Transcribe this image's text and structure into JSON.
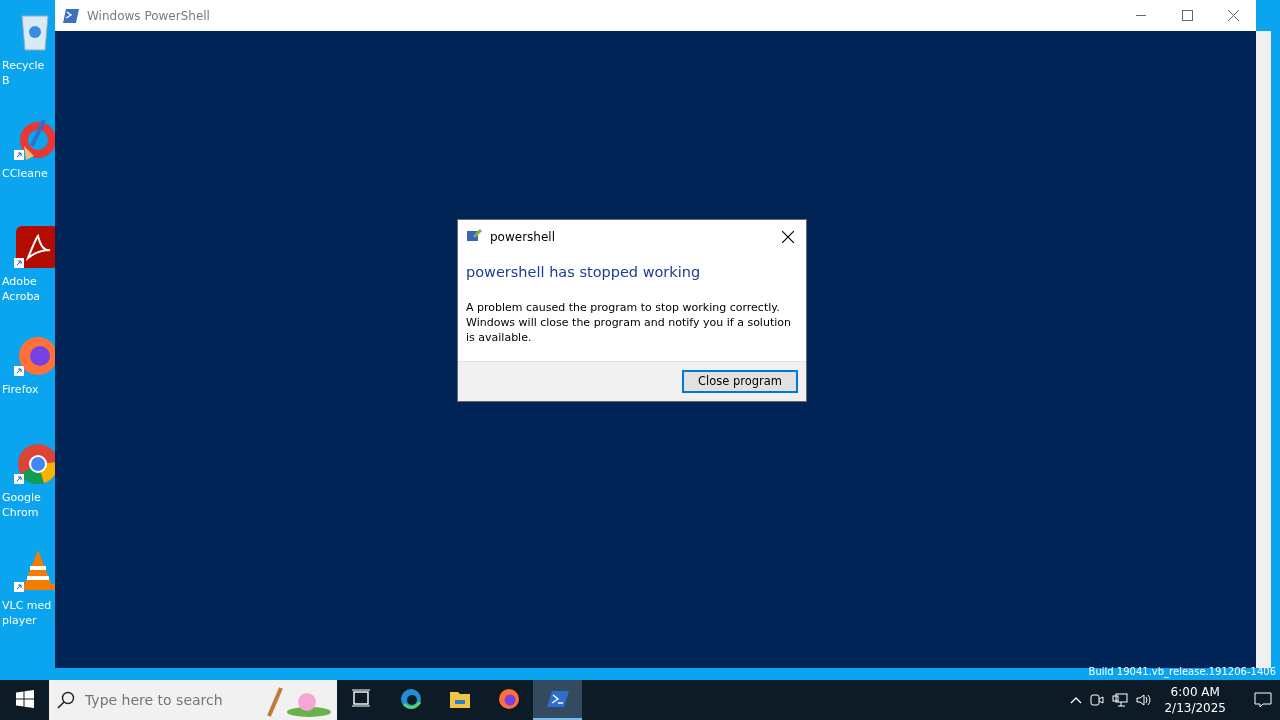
{
  "desktop_icons": [
    {
      "kind": "recycle",
      "label": "Recycle B"
    },
    {
      "kind": "ccleaner",
      "label": "CCleane"
    },
    {
      "kind": "acrobat",
      "label": "Adobe Acroba"
    },
    {
      "kind": "firefox",
      "label": "Firefox"
    },
    {
      "kind": "chrome",
      "label": "Google Chrom"
    },
    {
      "kind": "vlc",
      "label": "VLC med player"
    }
  ],
  "window": {
    "title": "Windows PowerShell"
  },
  "dialog": {
    "title": "powershell",
    "heading": "powershell has stopped working",
    "message": "A problem caused the program to stop working correctly. Windows will close the program and notify you if a solution is available.",
    "buttons": [
      {
        "label": "Close program",
        "focused": true
      }
    ]
  },
  "build_text": "Build 19041.vb_release.191206-1406",
  "taskbar": {
    "search": {
      "placeholder": "Type here to search"
    },
    "apps": [
      {
        "kind": "taskview",
        "selected": false
      },
      {
        "kind": "edge",
        "selected": false
      },
      {
        "kind": "explorer",
        "selected": false
      },
      {
        "kind": "firefox",
        "selected": false
      },
      {
        "kind": "powershell",
        "selected": true
      }
    ],
    "tray": {
      "time": "6:00 AM",
      "date": "2/13/2025"
    }
  }
}
